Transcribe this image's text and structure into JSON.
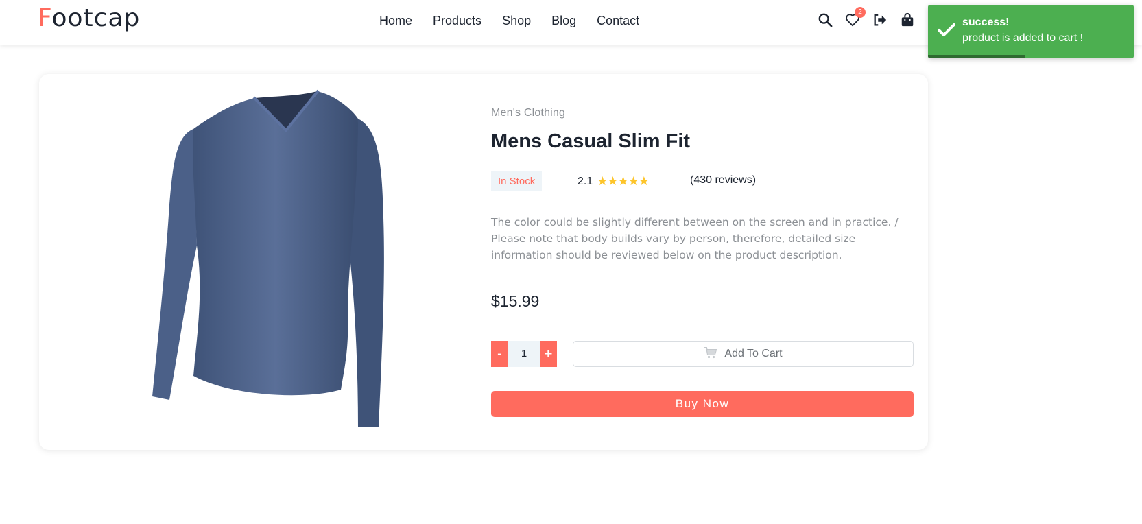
{
  "header": {
    "logo_first": "F",
    "logo_rest": "ootcap",
    "nav": [
      "Home",
      "Products",
      "Shop",
      "Blog",
      "Contact"
    ],
    "wishlist_count": "2",
    "icons": [
      "search-icon",
      "heart-icon",
      "logout-icon",
      "shopping-bag-icon"
    ]
  },
  "toast": {
    "title": "success!",
    "message": "product is added to cart !",
    "progress": 0.47,
    "color": "#4caf50"
  },
  "product": {
    "category": "Men's Clothing",
    "title": "Mens Casual Slim Fit",
    "stock": "In Stock",
    "rating": "2.1",
    "stars": "★★★★★",
    "reviews": "(430 reviews)",
    "description": "The color could be slightly different between on the screen and in practice. / Please note that body builds vary by person, therefore, detailed size information should be reviewed below on the product description.",
    "price": "$15.99",
    "quantity": "1",
    "minus_label": "-",
    "plus_label": "+",
    "add_to_cart_label": "Add To Cart",
    "buy_now_label": "Buy Now"
  },
  "colors": {
    "accent": "#ff6b5e",
    "star": "#fdc52b",
    "shirt": "#4b6088"
  }
}
